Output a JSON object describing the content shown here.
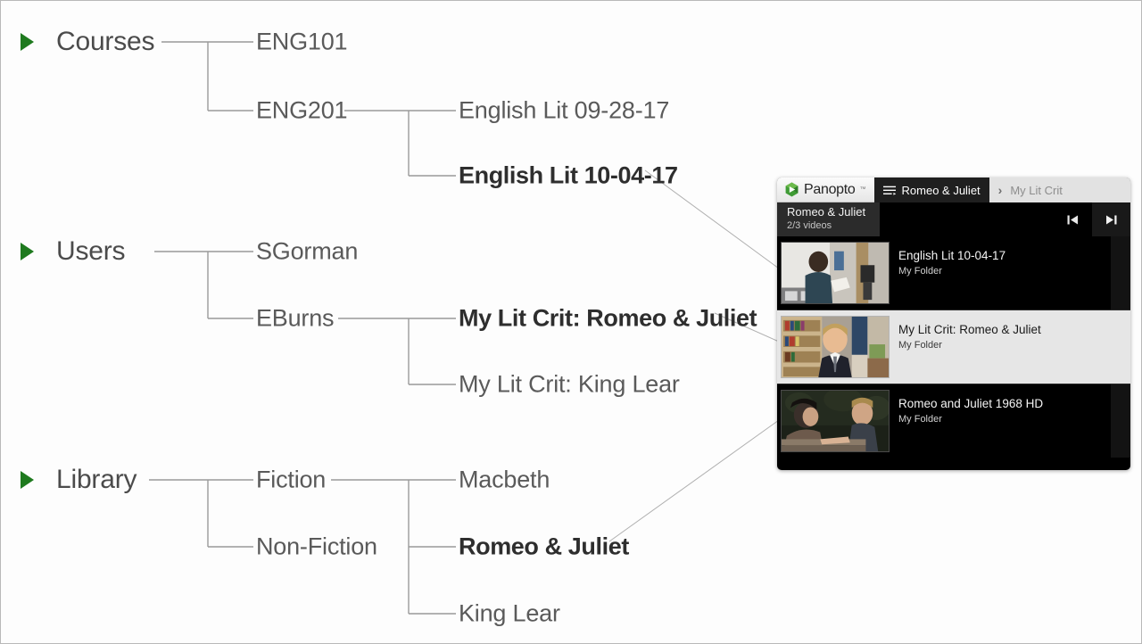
{
  "background_color": "#fdfdfd",
  "accent_green": "#1e7a1e",
  "tree": {
    "roots": [
      {
        "id": "courses",
        "label": "Courses",
        "bold": false
      },
      {
        "id": "users",
        "label": "Users",
        "bold": false
      },
      {
        "id": "library",
        "label": "Library",
        "bold": false
      }
    ],
    "nodes": [
      {
        "id": "eng101",
        "label": "ENG101",
        "bold": false
      },
      {
        "id": "eng201",
        "label": "ENG201",
        "bold": false
      },
      {
        "id": "englit0928",
        "label": "English Lit 09-28-17",
        "bold": false
      },
      {
        "id": "englit1004",
        "label": "English Lit 10-04-17",
        "bold": true
      },
      {
        "id": "sgorman",
        "label": "SGorman",
        "bold": false
      },
      {
        "id": "eburns",
        "label": "EBurns",
        "bold": false
      },
      {
        "id": "mlcrj",
        "label": "My Lit Crit: Romeo & Juliet",
        "bold": true
      },
      {
        "id": "mlckl",
        "label": "My Lit Crit: King Lear",
        "bold": false
      },
      {
        "id": "fiction",
        "label": "Fiction",
        "bold": false
      },
      {
        "id": "nonfiction",
        "label": "Non-Fiction",
        "bold": false
      },
      {
        "id": "macbeth",
        "label": "Macbeth",
        "bold": false
      },
      {
        "id": "romeojuliet",
        "label": "Romeo & Juliet",
        "bold": true
      },
      {
        "id": "kinglear",
        "label": "King Lear",
        "bold": false
      }
    ]
  },
  "panopto": {
    "logo_text": "Panopto",
    "logo_tm": "™",
    "breadcrumb": {
      "active": "Romeo & Juliet",
      "separator": "›",
      "inactive": "My Lit Crit"
    },
    "playlist_title": "Romeo & Juliet",
    "playlist_count": "2/3 videos",
    "prev_label": "Previous video",
    "next_label": "Next video",
    "videos": [
      {
        "title": "English Lit 10-04-17",
        "folder": "My Folder",
        "selected": false,
        "thumb": "student-reading-at-lectern"
      },
      {
        "title": "My Lit Crit: Romeo & Juliet",
        "folder": "My Folder",
        "selected": true,
        "thumb": "student-in-suit-bookshelf"
      },
      {
        "title": "Romeo and Juliet 1968 HD",
        "folder": "My Folder",
        "selected": false,
        "thumb": "balcony-scene-two-actors"
      }
    ]
  }
}
